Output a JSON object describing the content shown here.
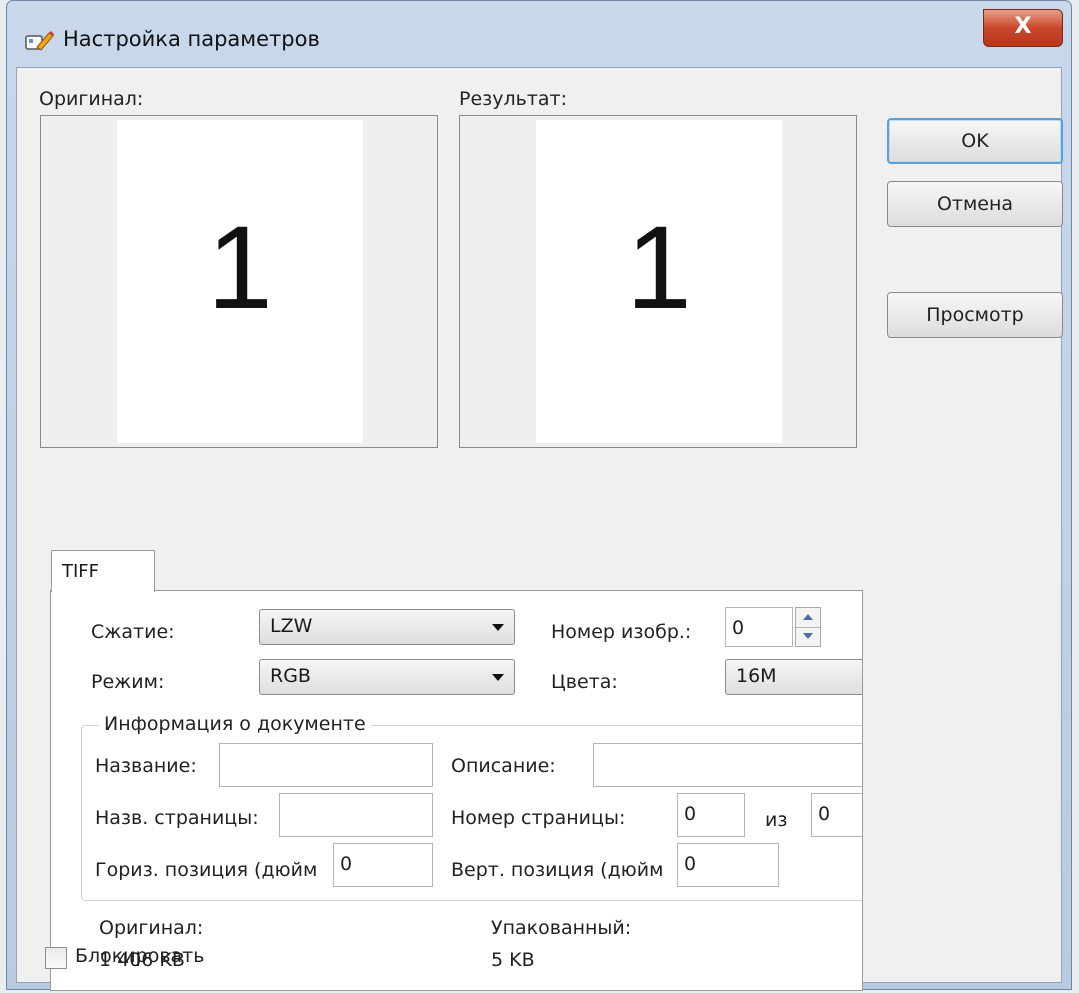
{
  "window": {
    "title": "Настройка параметров",
    "close_glyph": "X",
    "icon": "settings-pencil-icon"
  },
  "previews": {
    "original_label": "Оригинал:",
    "result_label": "Результат:",
    "original_page": "1",
    "result_page": "1"
  },
  "buttons": {
    "ok": "OK",
    "cancel": "Отмена",
    "preview": "Просмотр"
  },
  "tab": {
    "label": "TIFF"
  },
  "settings": {
    "compression_label": "Сжатие:",
    "compression_value": "LZW",
    "mode_label": "Режим:",
    "mode_value": "RGB",
    "image_number_label": "Номер изобр.:",
    "image_number_value": "0",
    "colors_label": "Цвета:",
    "colors_value": "16M"
  },
  "doc_info": {
    "group_title": "Информация о документе",
    "name_label": "Название:",
    "name_value": "",
    "description_label": "Описание:",
    "description_value": "",
    "page_name_label": "Назв. страницы:",
    "page_name_value": "",
    "page_number_label": "Номер страницы:",
    "page_number_value": "0",
    "of_label": "из",
    "page_total_value": "0",
    "hpos_label": "Гориз. позиция (дюйм",
    "hpos_value": "0",
    "vpos_label": "Верт. позиция (дюйм",
    "vpos_value": "0"
  },
  "sizes": {
    "original_label": "Оригинал:",
    "original_value": "1 406 KB",
    "packed_label": "Упакованный:",
    "packed_value": "5 KB"
  },
  "lock": {
    "label": "Блокировать",
    "checked": false
  }
}
